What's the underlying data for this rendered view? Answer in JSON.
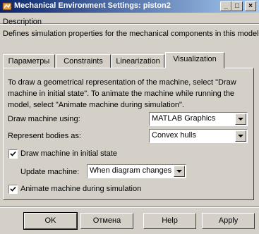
{
  "window": {
    "title": "Mechanical Environment Settings: piston2"
  },
  "titlebar_buttons": {
    "minimize": "_",
    "maximize": "□",
    "close": "×"
  },
  "description": {
    "label": "Description",
    "text": "Defines simulation properties for the mechanical components in this model."
  },
  "tabs": [
    {
      "label": "Параметры",
      "active": false
    },
    {
      "label": "Constraints",
      "active": false
    },
    {
      "label": "Linearization",
      "active": false
    },
    {
      "label": "Visualization",
      "active": true
    }
  ],
  "visualization": {
    "intro": "To draw a geometrical representation of the machine, select \"Draw machine in initial state\". To animate the machine while running the model, select \"Animate machine during simulation\".",
    "draw_machine_using": {
      "label": "Draw machine using:",
      "value": "MATLAB Graphics"
    },
    "represent_bodies_as": {
      "label": "Represent bodies as:",
      "value": "Convex hulls"
    },
    "draw_initial_state": {
      "label": "Draw machine in initial state",
      "checked": true
    },
    "update_machine": {
      "label": "Update machine:",
      "value": "When diagram changes"
    },
    "animate_during_sim": {
      "label": "Animate machine during simulation",
      "checked": true
    }
  },
  "buttons": {
    "ok": "OK",
    "cancel": "Отмена",
    "help": "Help",
    "apply": "Apply"
  },
  "colors": {
    "title_start": "#0a246a",
    "title_end": "#a6caf0",
    "face": "#d4d0c8"
  }
}
